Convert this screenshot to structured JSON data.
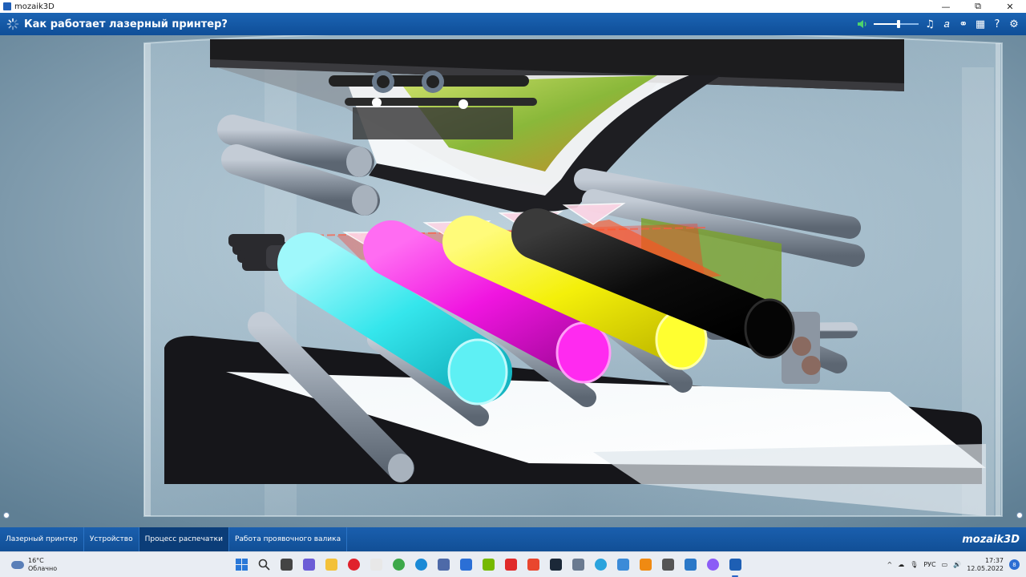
{
  "window": {
    "title": "mozaik3D",
    "controls": {
      "minimize": "—",
      "maximize": "⧉",
      "close": "✕"
    }
  },
  "toolbar": {
    "title": "Как работает лазерный принтер?",
    "volume_level": 0.55,
    "icons": [
      "volume-icon",
      "music-icon",
      "text-style-icon",
      "link-icon",
      "layout-icon",
      "help-icon",
      "settings-icon"
    ],
    "glyphs": {
      "music": "♫",
      "text": "𝑎",
      "link": "⚭",
      "layout": "▦",
      "help": "?",
      "settings": "⚙"
    }
  },
  "scene": {
    "rollers": [
      {
        "color": "#35e6ec"
      },
      {
        "color": "#f015e0"
      },
      {
        "color": "#f4f00a"
      },
      {
        "color": "#0b0b0b"
      }
    ],
    "accent_colors": {
      "laser": "#ff3020",
      "paper": "#ffffff",
      "glass": "#9fc4d8"
    }
  },
  "nav": {
    "tabs": [
      "Лазерный принтер",
      "Устройство",
      "Процесс распечатки",
      "Работа проявочного валика"
    ],
    "active_index": 2,
    "brand": "mozaik3D"
  },
  "taskbar": {
    "weather": {
      "temp": "16°C",
      "condition": "Облачно"
    },
    "apps": [
      {
        "name": "start-icon",
        "color": "#2a78d8"
      },
      {
        "name": "search-icon",
        "color": "#333333"
      },
      {
        "name": "task-view-icon",
        "color": "#444444"
      },
      {
        "name": "chat-icon",
        "color": "#6b5cd6"
      },
      {
        "name": "explorer-icon",
        "color": "#f3c13a"
      },
      {
        "name": "opera-icon",
        "color": "#e0222c"
      },
      {
        "name": "yandex-browser-icon",
        "color": "#e8e8e8"
      },
      {
        "name": "chrome-icon",
        "color": "#3da84a"
      },
      {
        "name": "edge-icon",
        "color": "#1a8ad6"
      },
      {
        "name": "store-settings-icon",
        "color": "#4e6aa8"
      },
      {
        "name": "ms-store-icon",
        "color": "#2b6fd6"
      },
      {
        "name": "nvidia-icon",
        "color": "#76b900"
      },
      {
        "name": "yandex-icon",
        "color": "#e02a2a"
      },
      {
        "name": "ea-icon",
        "color": "#e9462e"
      },
      {
        "name": "steam-icon",
        "color": "#1b2838"
      },
      {
        "name": "calculator-icon",
        "color": "#6a7a90"
      },
      {
        "name": "telegram-icon",
        "color": "#2aa3dd"
      },
      {
        "name": "notepad-icon",
        "color": "#3b8bd8"
      },
      {
        "name": "vlc-icon",
        "color": "#f08a12"
      },
      {
        "name": "camera-icon",
        "color": "#555555"
      },
      {
        "name": "remote-desktop-icon",
        "color": "#2a78c8"
      },
      {
        "name": "alice-icon",
        "color": "#8b5cf6"
      },
      {
        "name": "mozaik-icon",
        "color": "#1e5fb4"
      }
    ],
    "active_app": 22,
    "tray": {
      "chevron": "^",
      "language": "РУС",
      "time": "17:37",
      "date": "12.05.2022",
      "notifications": "8"
    }
  }
}
